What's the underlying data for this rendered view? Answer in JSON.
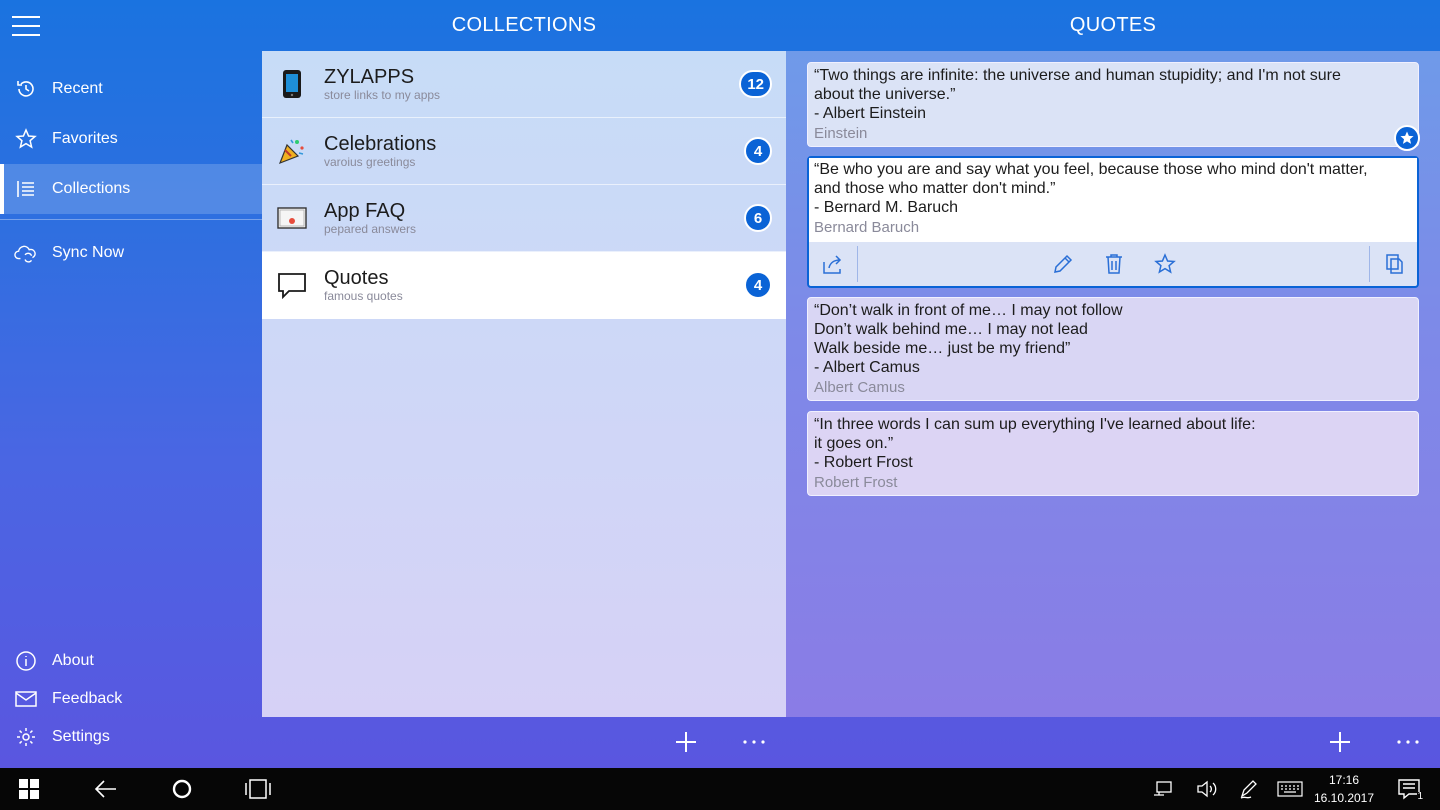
{
  "header": {
    "collections_title": "COLLECTIONS",
    "quotes_title": "QUOTES"
  },
  "nav": {
    "items": [
      {
        "label": "Recent",
        "icon": "history-icon"
      },
      {
        "label": "Favorites",
        "icon": "star-icon"
      },
      {
        "label": "Collections",
        "icon": "list-icon",
        "selected": true
      },
      {
        "label": "Sync Now",
        "icon": "cloud-sync-icon"
      }
    ],
    "bottom": [
      {
        "label": "About",
        "icon": "info-icon"
      },
      {
        "label": "Feedback",
        "icon": "mail-icon"
      },
      {
        "label": "Settings",
        "icon": "gear-icon"
      }
    ]
  },
  "collections": [
    {
      "name": "ZYLAPPS",
      "subtitle": "store links to my apps",
      "count": "12",
      "icon": "phone-icon"
    },
    {
      "name": "Celebrations",
      "subtitle": "varoius greetings",
      "count": "4",
      "icon": "party-popper-icon"
    },
    {
      "name": "App FAQ",
      "subtitle": "pepared answers",
      "count": "6",
      "icon": "envelope-icon"
    },
    {
      "name": "Quotes",
      "subtitle": "famous quotes",
      "count": "4",
      "icon": "speech-bubble-icon",
      "selected": true
    }
  ],
  "quotes": [
    {
      "text": "“Two things are infinite: the universe and human stupidity; and I'm not sure\nabout the universe.”\n- Albert Einstein",
      "author": "Einstein",
      "favorite": true
    },
    {
      "text": "“Be who you are and say what you feel, because those who mind don't matter,\nand those who matter don't mind.”\n- Bernard M. Baruch",
      "author": "Bernard Baruch",
      "selected": true
    },
    {
      "text": "“Don’t walk in front of me… I may not follow\nDon’t walk behind me… I may not lead\nWalk beside me… just be my friend”\n- Albert Camus",
      "author": "Albert Camus"
    },
    {
      "text": "“In three words I can sum up everything I've learned about life:\nit goes on.”\n- Robert Frost",
      "author": "Robert Frost"
    }
  ],
  "taskbar": {
    "time": "17:16",
    "date": "16.10.2017",
    "notification_count": "1"
  },
  "colors": {
    "accent": "#0a63d6",
    "header_blue": "#1a73e0",
    "bottom_purple": "#5a56e0"
  }
}
